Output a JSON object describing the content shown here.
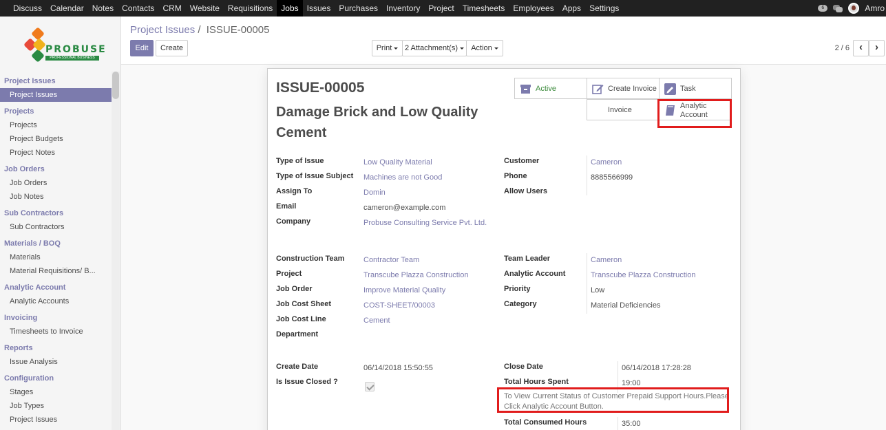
{
  "topbar": {
    "menu": [
      "Discuss",
      "Calendar",
      "Notes",
      "Contacts",
      "CRM",
      "Website",
      "Requisitions",
      "Jobs",
      "Issues",
      "Purchases",
      "Inventory",
      "Project",
      "Timesheets",
      "Employees",
      "Apps",
      "Settings"
    ],
    "active_menu": "Jobs",
    "notification_count": "6",
    "user": "Amro"
  },
  "logo": {
    "brand": "PROBUSE",
    "tagline": "PROFESSIONAL BUSINESS"
  },
  "sidebar": {
    "sections": [
      {
        "title": "Project Issues",
        "items": [
          "Project Issues"
        ]
      },
      {
        "title": "Projects",
        "items": [
          "Projects",
          "Project Budgets",
          "Project Notes"
        ]
      },
      {
        "title": "Job Orders",
        "items": [
          "Job Orders",
          "Job Notes"
        ]
      },
      {
        "title": "Sub Contractors",
        "items": [
          "Sub Contractors"
        ]
      },
      {
        "title": "Materials / BOQ",
        "items": [
          "Materials",
          "Material Requisitions/ B..."
        ]
      },
      {
        "title": "Analytic Account",
        "items": [
          "Analytic Accounts"
        ]
      },
      {
        "title": "Invoicing",
        "items": [
          "Timesheets to Invoice"
        ]
      },
      {
        "title": "Reports",
        "items": [
          "Issue Analysis"
        ]
      },
      {
        "title": "Configuration",
        "items": [
          "Stages",
          "Job Types",
          "Project Issues"
        ]
      }
    ],
    "active_item": "Project Issues"
  },
  "breadcrumb": {
    "parent": "Project Issues",
    "separator": "/",
    "current": "ISSUE-00005"
  },
  "buttons": {
    "edit": "Edit",
    "create": "Create",
    "print": "Print",
    "attachments": "2 Attachment(s)",
    "action": "Action"
  },
  "pager": {
    "text": "2 / 6",
    "prev": "‹",
    "next": "›"
  },
  "record": {
    "id": "ISSUE-00005",
    "name": "Damage Brick and Low Quality Cement"
  },
  "smart_buttons": {
    "active": "Active",
    "create_invoice": "Create Invoice",
    "task": "Task",
    "invoice": "Invoice",
    "analytic_account": "Analytic Account"
  },
  "fields": {
    "type_of_issue": {
      "label": "Type of Issue",
      "value": "Low Quality Material"
    },
    "type_of_issue_subject": {
      "label": "Type of Issue Subject",
      "value": "Machines are not Good"
    },
    "assign_to": {
      "label": "Assign To",
      "value": "Domin"
    },
    "email": {
      "label": "Email",
      "value": "cameron@example.com"
    },
    "company": {
      "label": "Company",
      "value": "Probuse Consulting Service Pvt. Ltd."
    },
    "customer": {
      "label": "Customer",
      "value": "Cameron"
    },
    "phone": {
      "label": "Phone",
      "value": "8885566999"
    },
    "allow_users": {
      "label": "Allow Users",
      "value": ""
    },
    "construction_team": {
      "label": "Construction Team",
      "value": "Contractor Team"
    },
    "project": {
      "label": "Project",
      "value": "Transcube Plazza Construction"
    },
    "job_order": {
      "label": "Job Order",
      "value": "Improve Material Quality"
    },
    "job_cost_sheet": {
      "label": "Job Cost Sheet",
      "value": "COST-SHEET/00003"
    },
    "job_cost_line": {
      "label": "Job Cost Line",
      "value": "Cement"
    },
    "department": {
      "label": "Department",
      "value": ""
    },
    "team_leader": {
      "label": "Team Leader",
      "value": "Cameron"
    },
    "analytic_account": {
      "label": "Analytic Account",
      "value": "Transcube Plazza Construction"
    },
    "priority": {
      "label": "Priority",
      "value": "Low"
    },
    "category": {
      "label": "Category",
      "value": "Material Deficiencies"
    },
    "create_date": {
      "label": "Create Date",
      "value": "06/14/2018 15:50:55"
    },
    "is_issue_closed": {
      "label": "Is Issue Closed ?",
      "value": true
    },
    "close_date": {
      "label": "Close Date",
      "value": "06/14/2018 17:28:28"
    },
    "total_hours_spent": {
      "label": "Total Hours Spent",
      "value": "19:00"
    },
    "total_consumed_hours": {
      "label": "Total Consumed Hours",
      "value": "35:00"
    }
  },
  "note": {
    "line1": "To View Current Status of Customer Prepaid Support Hours.Please",
    "line2": "Click Analytic Account Button."
  },
  "colors": {
    "accent": "#7c7bad",
    "highlight": "#e11c1c",
    "topbar": "#212121"
  }
}
